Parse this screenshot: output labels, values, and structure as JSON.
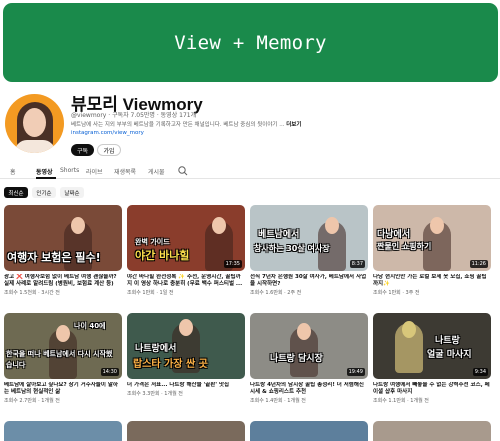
{
  "banner": {
    "text": "View + Memory",
    "color": "#1a8a4b"
  },
  "channel": {
    "name": "뷰모리 Viewmory",
    "meta": "@viewmory · 구독자 7.05만명 · 동영상 171개",
    "description": "베트남에 사는 지외 부부의 베트남을 기록하고자 만든 채널입니다. 베트남 중심의 뒷이야기 ...",
    "more": "더보기",
    "link": "instagram.com/view_mory",
    "subscribe_label": "구독",
    "join_label": "가입"
  },
  "tabs": [
    {
      "label": "홈",
      "active": false
    },
    {
      "label": "동영상",
      "active": true
    },
    {
      "label": "Shorts",
      "active": false
    },
    {
      "label": "라이브",
      "active": false
    },
    {
      "label": "재생목록",
      "active": false
    },
    {
      "label": "게시물",
      "active": false
    }
  ],
  "chips": [
    {
      "label": "최신순",
      "active": true
    },
    {
      "label": "인기순",
      "active": false
    },
    {
      "label": "날짜순",
      "active": false
    }
  ],
  "videos": [
    {
      "overlay1": "여행자 보험은 필수!",
      "overlay2": "",
      "duration": "",
      "title": "광고 ❌ 여행자보험 없이 베트남 여행 괜찮을까? 실제 사례로 알려드림 (병원비, 보험료 계산 등)",
      "meta": "조회수 1.5천회 · 3시간 전",
      "bg": "#7a4a38"
    },
    {
      "overlay1": "완벽 가이드",
      "overlay2": "야간 바나힐",
      "duration": "17:35",
      "title": "야간 바나힐 완전정복 ✨ 추천, 운영시간, 꿀팁까지 이 영상 하나로 충분히 (무료 백수 퍼스티벌 ...",
      "meta": "조회수 1만회 · 1일 전",
      "bg": "#8a3d2c"
    },
    {
      "overlay1": "베트남에서",
      "overlay2": "창사하는 30살 여사장",
      "duration": "8:37",
      "title": "전직 7년차 은행원 30살 여자가, 베트남에서 사업을 시작하면?",
      "meta": "조회수 1.6만회 · 2주 전",
      "bg": "#b9c4c7"
    },
    {
      "overlay1": "다낭에서",
      "overlay2": "짠물인 쇼핑하기",
      "duration": "11:26",
      "title": "다낭 현지인만 가는 로컬 보세 옷 모집, 쇼핑 꿀팁까지✨",
      "meta": "조회수 1만회 · 3주 전",
      "bg": "#cdb8a9"
    },
    {
      "overlay1": "나이 40에",
      "overlay2": "한국을 떠나 베트남에서 다시 시작했습니다",
      "duration": "14:30",
      "title": "베트남에 살아보고 싶나요? 장기 거주자들이 말하는 베트남의 현실적인 삶",
      "meta": "조회수 2.7만회 · 1개월 전",
      "bg": "#6e6a52"
    },
    {
      "overlay1": "나트랑에서",
      "overlay2": "랍스타 가장 싼 곳",
      "duration": "",
      "title": "더 가격은 저표... 나트랑 해산물 '끝판' 맛집",
      "meta": "조회수 3.3만회 · 1개월 전",
      "bg": "#3f5a4d"
    },
    {
      "overlay1": "나트랑 담시장",
      "overlay2": "",
      "duration": "19:49",
      "title": "나트랑 4년차의 담시장 꿀팁 총정리! 더 저렴해진 시세 & 쇼핑리스트 추천",
      "meta": "조회수 1.4만회 · 1개월 전",
      "bg": "#8d8c86"
    },
    {
      "overlay1": "나트랑",
      "overlay2": "얼굴 마사지",
      "duration": "9:34",
      "title": "나트랑 여행에서 빼놓을 수 없는 강력추천 코스, 페이셜 샵후 마사지",
      "meta": "조회수 1.1만회 · 1개월 전",
      "bg": "#3d3a33"
    }
  ]
}
